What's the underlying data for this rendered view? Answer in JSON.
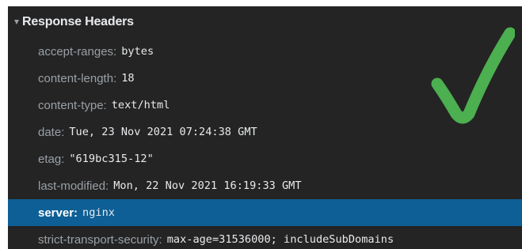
{
  "section": {
    "title": "Response Headers",
    "expanded": true
  },
  "headers": [
    {
      "name": "accept-ranges:",
      "value": "bytes"
    },
    {
      "name": "content-length:",
      "value": "18"
    },
    {
      "name": "content-type:",
      "value": "text/html"
    },
    {
      "name": "date:",
      "value": "Tue, 23 Nov 2021 07:24:38 GMT"
    },
    {
      "name": "etag:",
      "value": "\"619bc315-12\""
    },
    {
      "name": "last-modified:",
      "value": "Mon, 22 Nov 2021 16:19:33 GMT"
    },
    {
      "name": "server:",
      "value": "nginx"
    },
    {
      "name": "strict-transport-security:",
      "value": "max-age=31536000; includeSubDomains"
    }
  ],
  "selected_header_index": 6,
  "colors": {
    "panel_bg": "#242424",
    "selected_row_bg": "#0d5f95",
    "checkmark": "#4caf50"
  },
  "overlay_icon": "checkmark-icon"
}
